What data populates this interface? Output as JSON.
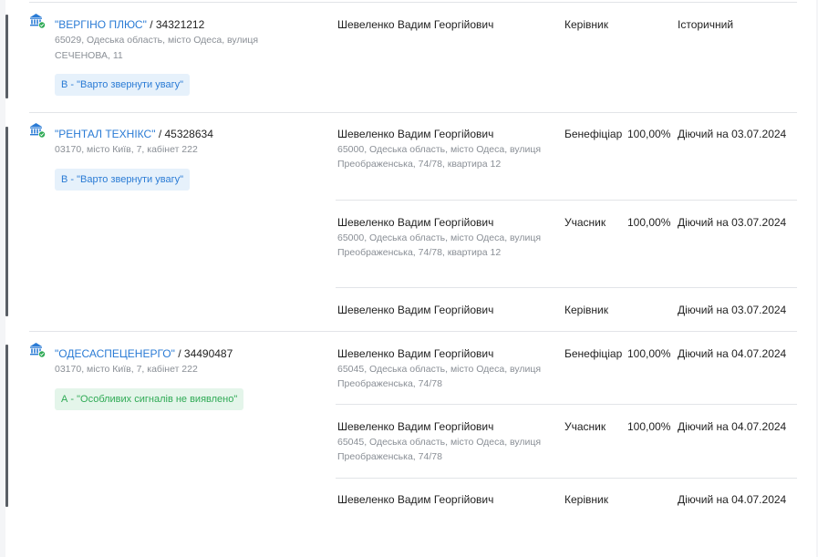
{
  "companies": [
    {
      "name": "\"ВЕРГІНО ПЛЮС\"",
      "code": "34321212",
      "address": "65029, Одеська область, місто Одеса, вулиця СЕЧЕНОВА, 11",
      "badge": "В - \"Варто звернути увагу\"",
      "rows": [
        {
          "person": "Шевеленко Вадим Георгійович",
          "address": "",
          "role": "Керівник",
          "share": "",
          "status": "Історичний"
        }
      ]
    },
    {
      "name": "\"РЕНТАЛ ТЕХНІКС\"",
      "code": "45328634",
      "address": "03170, місто Київ, 7, кабінет 222",
      "badge": "В - \"Варто звернути увагу\"",
      "rows": [
        {
          "person": "Шевеленко Вадим Георгійович",
          "address": "65000, Одеська область, місто Одеса, вулиця Преображенська, 74/78, квартира 12",
          "role": "Бенефіціар",
          "share": "100,00%",
          "status": "Діючий на 03.07.2024"
        },
        {
          "person": "Шевеленко Вадим Георгійович",
          "address": "65000, Одеська область, місто Одеса, вулиця Преображенська, 74/78, квартира 12",
          "role": "Учасник",
          "share": "100,00%",
          "status": "Діючий на 03.07.2024"
        },
        {
          "person": "Шевеленко Вадим Георгійович",
          "address": "",
          "role": "Керівник",
          "share": "",
          "status": "Діючий на 03.07.2024"
        }
      ]
    },
    {
      "name": "\"ОДЕСАСПЕЦЕНЕРГО\"",
      "code": "34490487",
      "address": "03170, місто Київ, 7, кабінет 222",
      "badge": "А - \"Особливих сигналів не виявлено\"",
      "rows": [
        {
          "person": "Шевеленко Вадим Георгійович",
          "address": "65045, Одеська область, місто Одеса, вулиця Преображенська, 74/78",
          "role": "Бенефіціар",
          "share": "100,00%",
          "status": "Діючий на 04.07.2024"
        },
        {
          "person": "Шевеленко Вадим Георгійович",
          "address": "65045, Одеська область, місто Одеса, вулиця Преображенська, 74/78",
          "role": "Учасник",
          "share": "100,00%",
          "status": "Діючий на 04.07.2024"
        },
        {
          "person": "Шевеленко Вадим Георгійович",
          "address": "",
          "role": "Керівник",
          "share": "",
          "status": "Діючий на 04.07.2024"
        }
      ]
    }
  ],
  "colors": {
    "link": "#2a7bd5",
    "warn_bg": "#e6f1fb",
    "ok_bg": "#e4f5ea",
    "ok_text": "#2faa55",
    "muted": "#8a8f96"
  },
  "icons": {
    "company": "bank-icon",
    "verified": "check-badge-icon"
  }
}
